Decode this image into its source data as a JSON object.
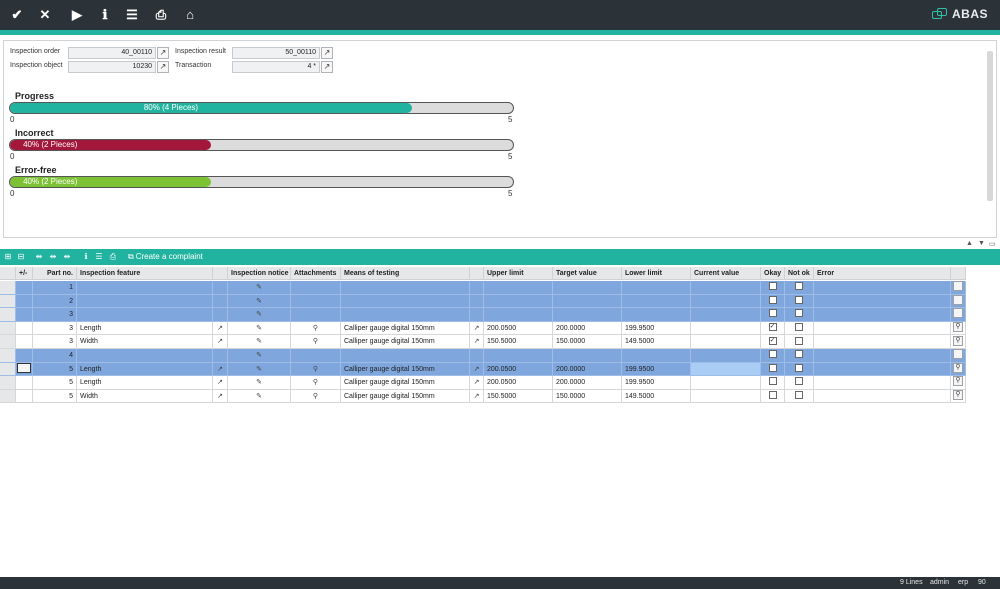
{
  "toolbar": {
    "buttons": [
      {
        "name": "confirm-icon",
        "glyph": "✔"
      },
      {
        "name": "close-icon",
        "glyph": "✕"
      },
      {
        "name": "play-icon",
        "glyph": "▶"
      },
      {
        "name": "info-icon",
        "glyph": "ℹ"
      },
      {
        "name": "menu-icon",
        "glyph": "☰"
      },
      {
        "name": "print-icon",
        "glyph": "⎙"
      },
      {
        "name": "home-icon",
        "glyph": "⌂"
      }
    ],
    "logo_text": "ABAS"
  },
  "header": {
    "inspection_order_label": "Inspection order",
    "inspection_order_value": "40_00110",
    "inspection_object_label": "Inspection object",
    "inspection_object_value": "10230",
    "inspection_result_label": "Inspection result",
    "inspection_result_value": "50_00110",
    "transaction_label": "Transaction",
    "transaction_value": "4 *"
  },
  "progress_bars": [
    {
      "title": "Progress",
      "text": "80% (4 Pieces)",
      "fraction": 0.8,
      "color": "#22b3a0",
      "min": "0",
      "max": "5"
    },
    {
      "title": "Incorrect",
      "text": "40% (2 Pieces)",
      "fraction": 0.4,
      "color": "#a3173b",
      "min": "0",
      "max": "5"
    },
    {
      "title": "Error-free",
      "text": "40% (2 Pieces)",
      "fraction": 0.4,
      "color": "#7dc135",
      "min": "0",
      "max": "5"
    }
  ],
  "grid_toolbar": {
    "complaint_label": "Create a complaint"
  },
  "table": {
    "headers": {
      "plusminus": "+/-",
      "part_no": "Part no.",
      "feature": "Inspection feature",
      "notice": "Inspection notice",
      "attachments": "Attachments",
      "means": "Means of testing",
      "upper": "Upper limit",
      "target": "Target value",
      "lower": "Lower limit",
      "current": "Current value",
      "okay": "Okay",
      "notok": "Not ok",
      "error": "Error"
    },
    "rows": [
      {
        "style": "sel",
        "part": "1",
        "feature": "",
        "means": "",
        "upper": "",
        "target": "",
        "lower": "",
        "okay": false,
        "notok": false,
        "detail": false
      },
      {
        "style": "sel",
        "part": "2",
        "feature": "",
        "means": "",
        "upper": "",
        "target": "",
        "lower": "",
        "okay": false,
        "notok": false,
        "detail": false
      },
      {
        "style": "sel",
        "part": "3",
        "feature": "",
        "means": "",
        "upper": "",
        "target": "",
        "lower": "",
        "okay": false,
        "notok": false,
        "detail": false
      },
      {
        "style": "normal",
        "part": "3",
        "feature": "Length",
        "means": "Calliper gauge digital 150mm",
        "upper": "200.0500",
        "target": "200.0000",
        "lower": "199.9500",
        "okay": true,
        "notok": false,
        "detail": true
      },
      {
        "style": "normal",
        "part": "3",
        "feature": "Width",
        "means": "Calliper gauge digital 150mm",
        "upper": "150.5000",
        "target": "150.0000",
        "lower": "149.5000",
        "okay": true,
        "notok": false,
        "detail": true
      },
      {
        "style": "sel",
        "part": "4",
        "feature": "",
        "means": "",
        "upper": "",
        "target": "",
        "lower": "",
        "okay": false,
        "notok": false,
        "detail": false
      },
      {
        "style": "sel current",
        "part": "5",
        "feature": "Length",
        "means": "Calliper gauge digital 150mm",
        "upper": "200.0500",
        "target": "200.0000",
        "lower": "199.9500",
        "okay": false,
        "notok": false,
        "detail": true
      },
      {
        "style": "normal",
        "part": "5",
        "feature": "Length",
        "means": "Calliper gauge digital 150mm",
        "upper": "200.0500",
        "target": "200.0000",
        "lower": "199.9500",
        "okay": false,
        "notok": false,
        "detail": true
      },
      {
        "style": "normal",
        "part": "5",
        "feature": "Width",
        "means": "Calliper gauge digital 150mm",
        "upper": "150.5000",
        "target": "150.0000",
        "lower": "149.5000",
        "okay": false,
        "notok": false,
        "detail": true
      }
    ]
  },
  "footer": {
    "lines": "9 Lines",
    "user": "admin",
    "client": "erp",
    "code": "90"
  }
}
